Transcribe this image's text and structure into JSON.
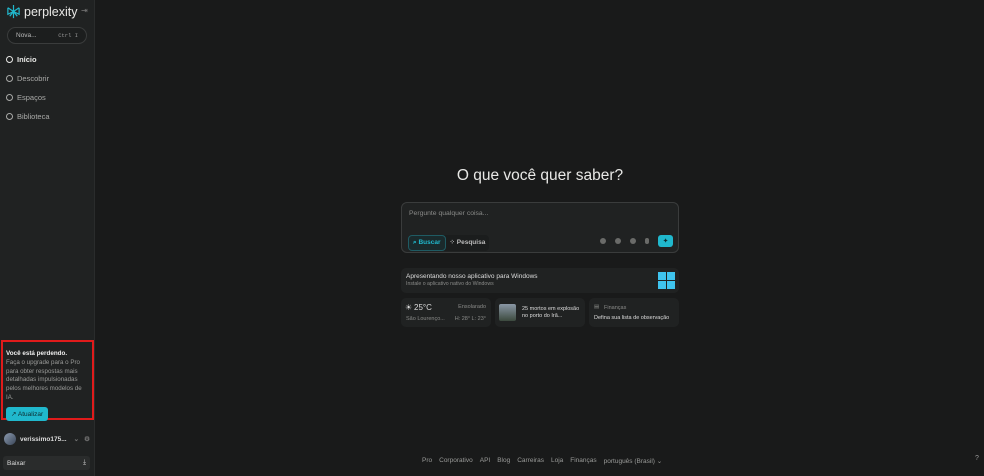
{
  "sidebar": {
    "brand": "perplexity",
    "new_thread": "Nova...",
    "shortcut": "Ctrl I",
    "items": [
      {
        "label": "Início"
      },
      {
        "label": "Descobrir"
      },
      {
        "label": "Espaços"
      },
      {
        "label": "Biblioteca"
      }
    ],
    "promo": {
      "title": "Você está perdendo.",
      "text": "Faça o upgrade para o Pro para obter respostas mais detalhadas impulsionadas pelos melhores modelos de IA.",
      "button": "Atualizar"
    },
    "user": "verissimo175...",
    "download": "Baixar"
  },
  "main": {
    "title": "O que você quer saber?",
    "search": {
      "placeholder": "Pergunte qualquer coisa...",
      "mode_search": "Buscar",
      "mode_research": "Pesquisa"
    },
    "windows_card": {
      "title": "Apresentando nosso aplicativo para Windows",
      "subtitle": "Instale o aplicativo nativo do Windows"
    },
    "weather": {
      "temp": "25°C",
      "condition": "Ensolarado",
      "location": "São Lourenço...",
      "range": "H: 28° L: 23°"
    },
    "news": {
      "headline": "25 mortos em explosão no porto do Irã..."
    },
    "finance": {
      "label": "Finanças",
      "text": "Defina sua lista de observação"
    }
  },
  "footer": {
    "links": [
      "Pro",
      "Corporativo",
      "API",
      "Blog",
      "Carreiras",
      "Loja",
      "Finanças",
      "português (Brasil)"
    ],
    "help": "?"
  }
}
